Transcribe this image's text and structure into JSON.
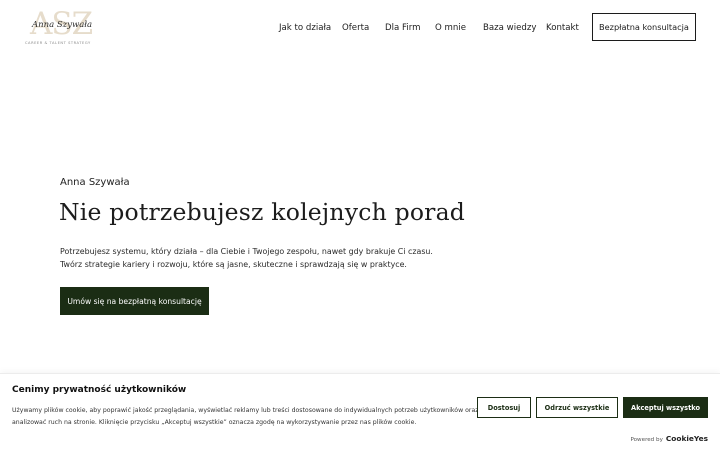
{
  "header": {
    "logo": {
      "monogram": "ASZ",
      "name": "Anna Szywała",
      "tagline": "CAREER & TALENT STRATEGY"
    },
    "nav": [
      {
        "label": "Jak to działa"
      },
      {
        "label": "Oferta"
      },
      {
        "label": "Dla Firm"
      },
      {
        "label": "O mnie"
      },
      {
        "label": "Baza wiedzy"
      },
      {
        "label": "Kontakt"
      }
    ],
    "cta_label": "Bezpłatna konsultacja"
  },
  "hero": {
    "kicker": "Anna Szywała",
    "title": "Nie potrzebujesz kolejnych porad",
    "description": [
      "Potrzebujesz systemu, który działa – dla Ciebie i Twojego zespołu, nawet gdy brakuje Ci czasu.",
      "Twórz strategie kariery i rozwoju, które są jasne, skuteczne i sprawdzają się w praktyce."
    ],
    "button_label": "Umów się na bezpłatną konsultację"
  },
  "cookie_banner": {
    "title": "Cenimy prywatność użytkowników",
    "text": [
      "Używamy plików cookie, aby poprawić jakość przeglądania, wyświetlać reklamy lub treści dostosowane do indywidualnych potrzeb użytkowników oraz",
      "analizować ruch na stronie. Kliknięcie przycisku „Akceptuj wszystkie” oznacza zgodę na wykorzystywanie przez nas plików cookie."
    ],
    "buttons": {
      "customize": "Dostosuj",
      "reject": "Odrzuć wszystkie",
      "accept": "Akceptuj wszystko"
    },
    "powered_by": {
      "label": "Powered by",
      "brand": "CookieYes"
    }
  },
  "colors": {
    "primary": "#1b2d14",
    "logo_monogram": "#e6dccb",
    "text": "#1c1c1c",
    "background": "#ffffff"
  }
}
